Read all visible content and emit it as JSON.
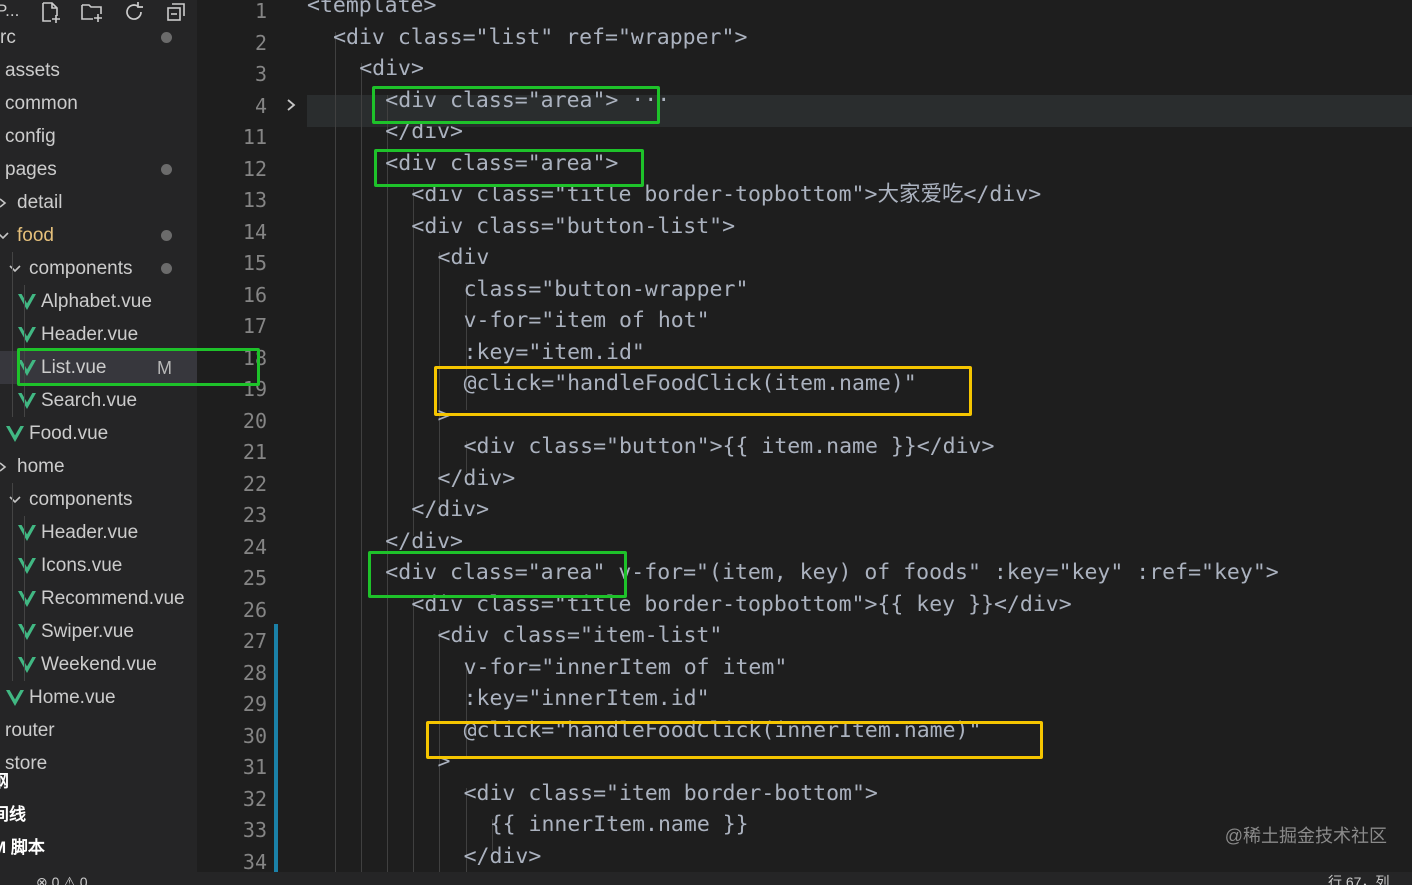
{
  "sidebar": {
    "header_title": "P...",
    "toolbar_icons": [
      "new-file-icon",
      "new-folder-icon",
      "refresh-icon",
      "collapse-all-icon"
    ],
    "tree": [
      {
        "label": "rc",
        "depth": 0,
        "dot": true
      },
      {
        "label": "assets"
      },
      {
        "label": "common"
      },
      {
        "label": "config"
      },
      {
        "label": "pages",
        "dot": true
      },
      {
        "label": "detail",
        "chevron": "right"
      },
      {
        "label": "food",
        "chevron": "down",
        "dot": true
      },
      {
        "label": "components",
        "chevron": "down",
        "dot": true
      },
      {
        "label": "Alphabet.vue",
        "vue": true
      },
      {
        "label": "Header.vue",
        "vue": true
      },
      {
        "label": "List.vue",
        "vue": true,
        "badge": "M"
      },
      {
        "label": "Search.vue",
        "vue": true
      },
      {
        "label": "Food.vue",
        "vue": true
      },
      {
        "label": "home",
        "chevron": "right"
      },
      {
        "label": "components",
        "chevron": "down"
      },
      {
        "label": "Header.vue",
        "vue": true
      },
      {
        "label": "Icons.vue",
        "vue": true
      },
      {
        "label": "Recommend.vue",
        "vue": true
      },
      {
        "label": "Swiper.vue",
        "vue": true
      },
      {
        "label": "Weekend.vue",
        "vue": true
      },
      {
        "label": "Home.vue",
        "vue": true
      },
      {
        "label": "router"
      },
      {
        "label": "store"
      }
    ],
    "panels": [
      "纲",
      "间线",
      "M 脚本"
    ]
  },
  "editor": {
    "line_numbers": [
      "1",
      "2",
      "3",
      "4",
      "11",
      "12",
      "13",
      "14",
      "15",
      "16",
      "17",
      "18",
      "19",
      "20",
      "21",
      "22",
      "23",
      "24",
      "25",
      "26",
      "27",
      "28",
      "29",
      "30",
      "31",
      "32",
      "33",
      "34"
    ],
    "lines": [
      [
        [
          "t-br",
          "<"
        ],
        [
          "t-tag",
          "template"
        ],
        [
          "t-br",
          ">"
        ]
      ],
      [
        [
          "t-br",
          "<"
        ],
        [
          "t-tag",
          "div"
        ],
        [
          "t-plain",
          " "
        ],
        [
          "t-attr",
          "class"
        ],
        [
          "t-plain",
          "="
        ],
        [
          "t-str",
          "\"list\""
        ],
        [
          "t-plain",
          " "
        ],
        [
          "t-attr",
          "ref"
        ],
        [
          "t-plain",
          "="
        ],
        [
          "t-str",
          "\"wrapper\""
        ],
        [
          "t-br",
          ">"
        ]
      ],
      [
        [
          "t-br",
          "<"
        ],
        [
          "t-tag",
          "div"
        ],
        [
          "t-br",
          ">"
        ]
      ],
      [
        [
          "t-br",
          "<"
        ],
        [
          "t-tag",
          "div"
        ],
        [
          "t-plain",
          " "
        ],
        [
          "t-attr",
          "class"
        ],
        [
          "t-plain",
          "="
        ],
        [
          "t-str",
          "\"area\""
        ],
        [
          "t-br",
          ">"
        ],
        [
          "t-dots",
          " ···"
        ]
      ],
      [
        [
          "t-br",
          "</"
        ],
        [
          "t-tag",
          "div"
        ],
        [
          "t-br",
          ">"
        ]
      ],
      [
        [
          "t-br",
          "<"
        ],
        [
          "t-tag",
          "div"
        ],
        [
          "t-plain",
          " "
        ],
        [
          "t-attr",
          "class"
        ],
        [
          "t-plain",
          "="
        ],
        [
          "t-str",
          "\"area\""
        ],
        [
          "t-br",
          ">"
        ]
      ],
      [
        [
          "t-br",
          "<"
        ],
        [
          "t-tag",
          "div"
        ],
        [
          "t-plain",
          " "
        ],
        [
          "t-attr",
          "class"
        ],
        [
          "t-plain",
          "="
        ],
        [
          "t-str",
          "\"title border-topbottom\""
        ],
        [
          "t-br",
          ">"
        ],
        [
          "t-cn",
          "大家爱吃"
        ],
        [
          "t-br",
          "</"
        ],
        [
          "t-tag",
          "div"
        ],
        [
          "t-br",
          ">"
        ]
      ],
      [
        [
          "t-br",
          "<"
        ],
        [
          "t-tag",
          "div"
        ],
        [
          "t-plain",
          " "
        ],
        [
          "t-attr",
          "class"
        ],
        [
          "t-plain",
          "="
        ],
        [
          "t-str",
          "\"button-list\""
        ],
        [
          "t-br",
          ">"
        ]
      ],
      [
        [
          "t-br",
          "<"
        ],
        [
          "t-tag",
          "div"
        ]
      ],
      [
        [
          "t-attr",
          "class"
        ],
        [
          "t-plain",
          "="
        ],
        [
          "t-str",
          "\"button-wrapper\""
        ]
      ],
      [
        [
          "t-attr",
          "v-for"
        ],
        [
          "t-plain",
          "="
        ],
        [
          "t-str",
          "\""
        ],
        [
          "t-tag",
          "item"
        ],
        [
          "t-plain",
          " "
        ],
        [
          "t-kw",
          "of"
        ],
        [
          "t-plain",
          " "
        ],
        [
          "t-tag",
          "hot"
        ],
        [
          "t-str",
          "\""
        ]
      ],
      [
        [
          "t-attr",
          ":key"
        ],
        [
          "t-plain",
          "="
        ],
        [
          "t-str",
          "\""
        ],
        [
          "t-tag",
          "item"
        ],
        [
          "t-plain",
          "."
        ],
        [
          "t-tag",
          "id"
        ],
        [
          "t-str",
          "\""
        ]
      ],
      [
        [
          "t-attr",
          "@click"
        ],
        [
          "t-plain",
          "="
        ],
        [
          "t-str",
          "\""
        ],
        [
          "t-fn",
          "handleFoodClick"
        ],
        [
          "t-plain",
          "("
        ],
        [
          "t-tag",
          "item"
        ],
        [
          "t-plain",
          "."
        ],
        [
          "t-tag",
          "name"
        ],
        [
          "t-plain",
          ")"
        ],
        [
          "t-str",
          "\""
        ]
      ],
      [
        [
          "t-br",
          ">"
        ]
      ],
      [
        [
          "t-br",
          "<"
        ],
        [
          "t-tag",
          "div"
        ],
        [
          "t-plain",
          " "
        ],
        [
          "t-attr",
          "class"
        ],
        [
          "t-plain",
          "="
        ],
        [
          "t-str",
          "\"button\""
        ],
        [
          "t-br",
          ">"
        ],
        [
          "t-plain",
          "{{ "
        ],
        [
          "t-tag",
          "item"
        ],
        [
          "t-plain",
          "."
        ],
        [
          "t-tag",
          "name"
        ],
        [
          "t-plain",
          " }}"
        ],
        [
          "t-br",
          "</"
        ],
        [
          "t-tag",
          "div"
        ],
        [
          "t-br",
          ">"
        ]
      ],
      [
        [
          "t-br",
          "</"
        ],
        [
          "t-tag",
          "div"
        ],
        [
          "t-br",
          ">"
        ]
      ],
      [
        [
          "t-br",
          "</"
        ],
        [
          "t-tag",
          "div"
        ],
        [
          "t-br",
          ">"
        ]
      ],
      [
        [
          "t-br",
          "</"
        ],
        [
          "t-tag",
          "div"
        ],
        [
          "t-br",
          ">"
        ]
      ],
      [
        [
          "t-br",
          "<"
        ],
        [
          "t-tag",
          "div"
        ],
        [
          "t-plain",
          " "
        ],
        [
          "t-attr",
          "class"
        ],
        [
          "t-plain",
          "="
        ],
        [
          "t-str",
          "\"area\""
        ],
        [
          "t-plain",
          " "
        ],
        [
          "t-attr",
          "v-for"
        ],
        [
          "t-plain",
          "="
        ],
        [
          "t-str",
          "\""
        ],
        [
          "t-plain",
          "("
        ],
        [
          "t-tag",
          "item"
        ],
        [
          "t-plain",
          ", "
        ],
        [
          "t-tag",
          "key"
        ],
        [
          "t-plain",
          ") "
        ],
        [
          "t-kw",
          "of"
        ],
        [
          "t-plain",
          " "
        ],
        [
          "t-tag",
          "foods"
        ],
        [
          "t-str",
          "\""
        ],
        [
          "t-plain",
          " "
        ],
        [
          "t-attr",
          ":key"
        ],
        [
          "t-plain",
          "="
        ],
        [
          "t-str",
          "\""
        ],
        [
          "t-tag",
          "key"
        ],
        [
          "t-str",
          "\""
        ],
        [
          "t-plain",
          " "
        ],
        [
          "t-attr",
          ":ref"
        ],
        [
          "t-plain",
          "="
        ],
        [
          "t-str",
          "\""
        ],
        [
          "t-tag",
          "key"
        ],
        [
          "t-str",
          "\""
        ],
        [
          "t-br",
          ">"
        ]
      ],
      [
        [
          "t-br",
          "<"
        ],
        [
          "t-tag",
          "div"
        ],
        [
          "t-plain",
          " "
        ],
        [
          "t-attr",
          "class"
        ],
        [
          "t-plain",
          "="
        ],
        [
          "t-str",
          "\"title border-topbottom\""
        ],
        [
          "t-br",
          ">"
        ],
        [
          "t-plain",
          "{{ "
        ],
        [
          "t-tag",
          "key"
        ],
        [
          "t-plain",
          " }}"
        ],
        [
          "t-br",
          "</"
        ],
        [
          "t-tag",
          "div"
        ],
        [
          "t-br",
          ">"
        ]
      ],
      [
        [
          "t-br",
          "<"
        ],
        [
          "t-tag",
          "div"
        ],
        [
          "t-plain",
          " "
        ],
        [
          "t-attr",
          "class"
        ],
        [
          "t-plain",
          "="
        ],
        [
          "t-str",
          "\"item-list\""
        ]
      ],
      [
        [
          "t-attr",
          "v-for"
        ],
        [
          "t-plain",
          "="
        ],
        [
          "t-str",
          "\""
        ],
        [
          "t-tag",
          "innerItem"
        ],
        [
          "t-plain",
          " "
        ],
        [
          "t-kw",
          "of"
        ],
        [
          "t-plain",
          " "
        ],
        [
          "t-tag",
          "item"
        ],
        [
          "t-str",
          "\""
        ]
      ],
      [
        [
          "t-attr",
          ":key"
        ],
        [
          "t-plain",
          "="
        ],
        [
          "t-str",
          "\""
        ],
        [
          "t-tag",
          "innerItem"
        ],
        [
          "t-plain",
          "."
        ],
        [
          "t-tag",
          "id"
        ],
        [
          "t-str",
          "\""
        ]
      ],
      [
        [
          "t-attr",
          "@click"
        ],
        [
          "t-plain",
          "="
        ],
        [
          "t-str",
          "\""
        ],
        [
          "t-fn",
          "handleFoodClick"
        ],
        [
          "t-plain",
          "("
        ],
        [
          "t-tag",
          "innerItem"
        ],
        [
          "t-plain",
          "."
        ],
        [
          "t-tag",
          "name"
        ],
        [
          "t-plain",
          ")"
        ],
        [
          "t-str",
          "\""
        ]
      ],
      [
        [
          "t-br",
          ">"
        ]
      ],
      [
        [
          "t-br",
          "<"
        ],
        [
          "t-tag",
          "div"
        ],
        [
          "t-plain",
          " "
        ],
        [
          "t-attr",
          "class"
        ],
        [
          "t-plain",
          "="
        ],
        [
          "t-str",
          "\"item border-bottom\""
        ],
        [
          "t-br",
          ">"
        ]
      ],
      [
        [
          "t-plain",
          "{{ "
        ],
        [
          "t-tag",
          "innerItem"
        ],
        [
          "t-plain",
          "."
        ],
        [
          "t-tag",
          "name"
        ],
        [
          "t-plain",
          " }}"
        ]
      ],
      [
        [
          "t-br",
          "</"
        ],
        [
          "t-tag",
          "div"
        ],
        [
          "t-br",
          ">"
        ]
      ]
    ]
  },
  "watermark": "@稀土掘金技术社区",
  "statusbar": {
    "left": "⊗ 0 ⚠ 0",
    "right": "行 67，列"
  },
  "colors": {
    "highlight_green": "#1ec22a",
    "highlight_yellow": "#f5c500",
    "git_modified": "#1b81a8"
  }
}
